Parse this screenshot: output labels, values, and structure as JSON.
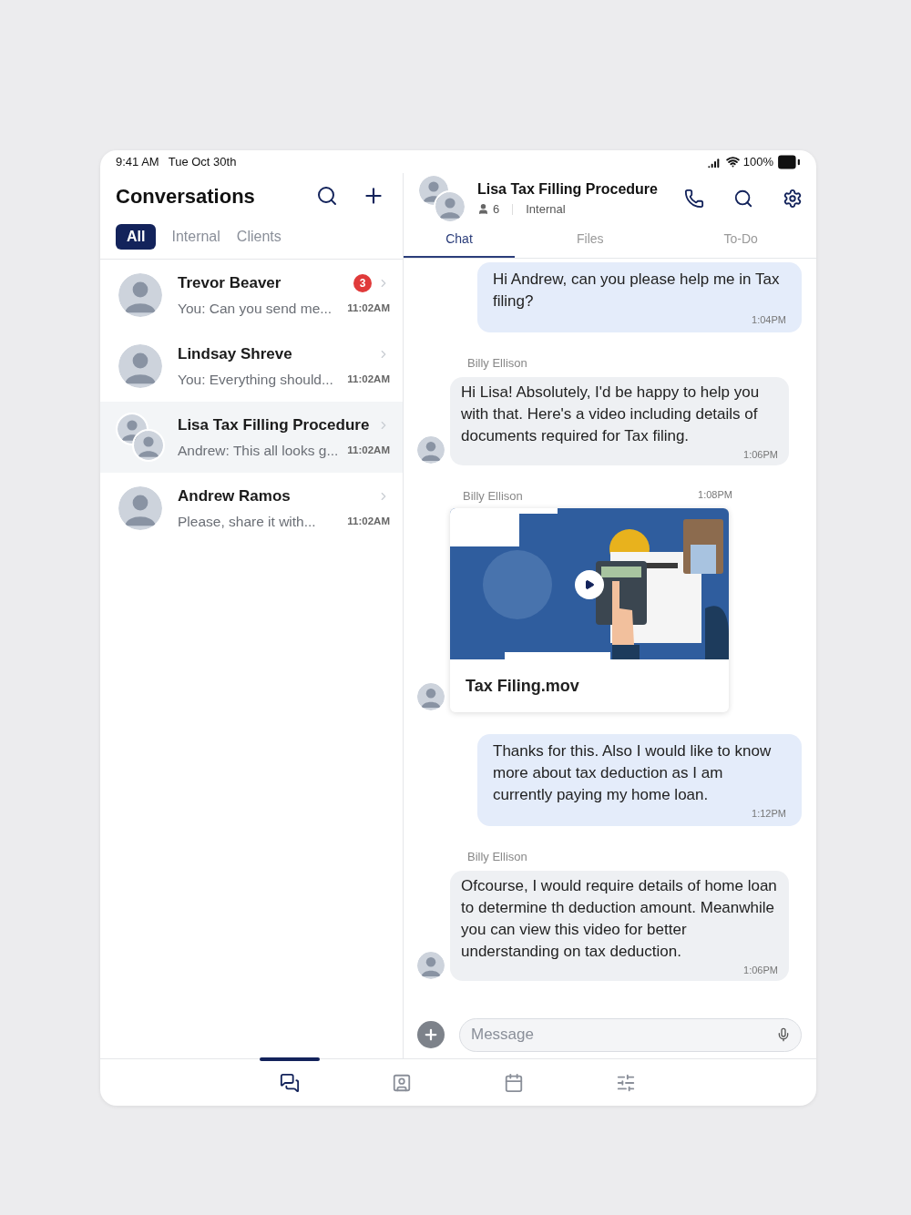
{
  "status_bar": {
    "time": "9:41 AM",
    "date": "Tue Oct 30th",
    "battery": "100%"
  },
  "conversations": {
    "title": "Conversations",
    "filters": [
      {
        "label": "All",
        "selected": true
      },
      {
        "label": "Internal",
        "selected": false
      },
      {
        "label": "Clients",
        "selected": false
      }
    ],
    "items": [
      {
        "name": "Trevor Beaver",
        "preview": "You: Can you send me...",
        "time": "11:02AM",
        "badge": "3",
        "selected": false,
        "kind": "single"
      },
      {
        "name": "Lindsay Shreve",
        "preview": "You: Everything should...",
        "time": "11:02AM",
        "selected": false,
        "kind": "single"
      },
      {
        "name": "Lisa Tax Filling Procedure",
        "preview": "Andrew: This all looks g...",
        "time": "11:02AM",
        "selected": true,
        "kind": "group"
      },
      {
        "name": "Andrew Ramos",
        "preview": "Please, share it with...",
        "time": "11:02AM",
        "selected": false,
        "kind": "single"
      }
    ]
  },
  "chat": {
    "title": "Lisa Tax Filling Procedure",
    "members": "6",
    "type": "Internal",
    "tabs": [
      {
        "label": "Chat",
        "selected": true
      },
      {
        "label": "Files",
        "selected": false
      },
      {
        "label": "To-Do",
        "selected": false
      }
    ],
    "messages": [
      {
        "kind": "outgoing",
        "text": "Hi Andrew, can you please help me in Tax filing?",
        "time": "1:04PM"
      },
      {
        "kind": "incoming",
        "sender": "Billy Ellison",
        "text": "Hi Lisa! Absolutely, I'd be happy to help you with that. Here's a video including details of documents required for Tax filing.",
        "time": "1:06PM"
      },
      {
        "kind": "video",
        "sender": "Billy Ellison",
        "file": "Tax Filing.mov",
        "time": "1:08PM"
      },
      {
        "kind": "outgoing",
        "text": "Thanks for this. Also I would like to know more about tax deduction as I am currently paying my home loan.",
        "time": "1:12PM"
      },
      {
        "kind": "incoming",
        "sender": "Billy Ellison",
        "text": "Ofcourse, I would require details of home loan to determine th deduction amount. Meanwhile you can view this video for better understanding on tax deduction.",
        "time": "1:06PM"
      }
    ],
    "input": {
      "placeholder": "Message"
    }
  },
  "bottom_nav": [
    {
      "kind": "chats",
      "selected": true
    },
    {
      "kind": "contacts",
      "selected": false
    },
    {
      "kind": "calendar",
      "selected": false
    },
    {
      "kind": "settings",
      "selected": false
    }
  ]
}
